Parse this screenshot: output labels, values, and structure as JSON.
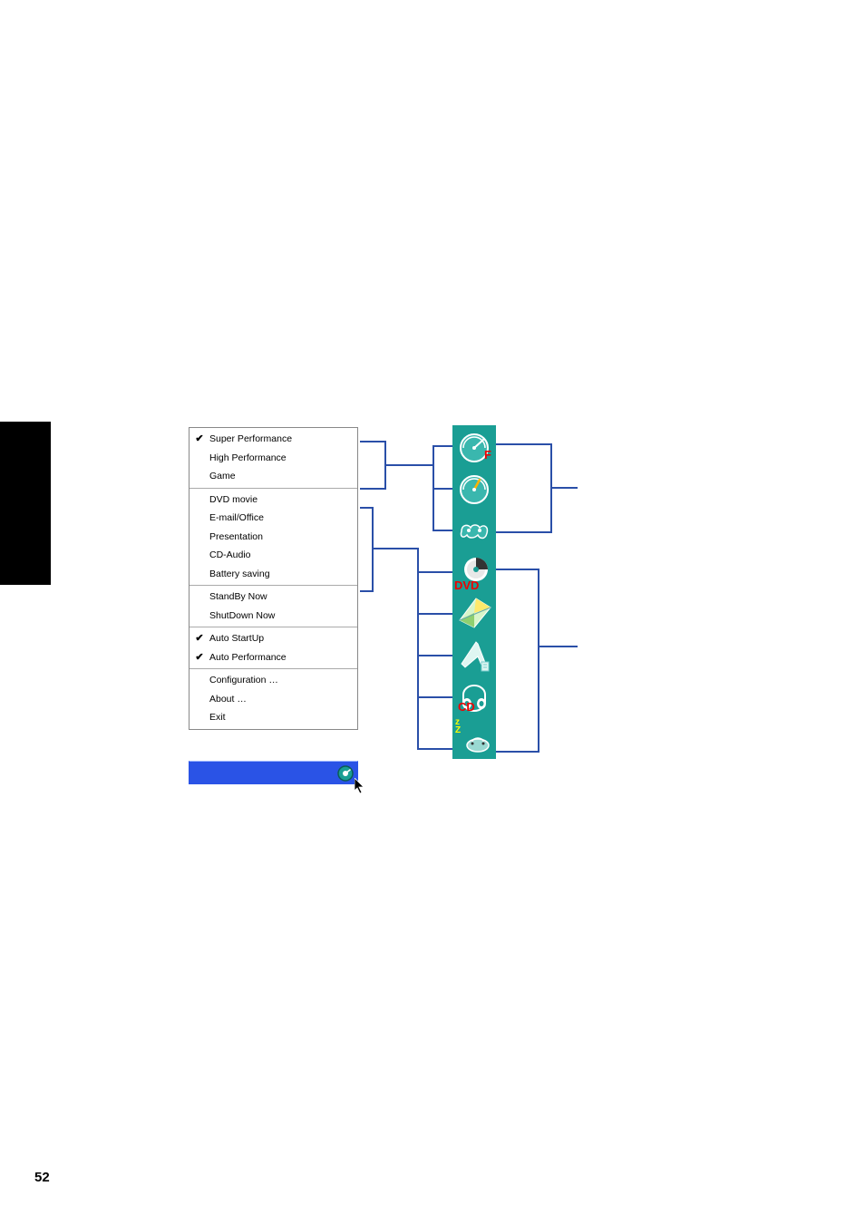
{
  "page_number": "52",
  "menu": {
    "groups": [
      {
        "items": [
          {
            "label": "Super Performance",
            "checked": true,
            "name": "menu-item-super-performance"
          },
          {
            "label": "High Performance",
            "checked": false,
            "name": "menu-item-high-performance"
          },
          {
            "label": "Game",
            "checked": false,
            "name": "menu-item-game"
          }
        ]
      },
      {
        "items": [
          {
            "label": "DVD movie",
            "checked": false,
            "name": "menu-item-dvd-movie"
          },
          {
            "label": "E-mail/Office",
            "checked": false,
            "name": "menu-item-email-office"
          },
          {
            "label": "Presentation",
            "checked": false,
            "name": "menu-item-presentation"
          },
          {
            "label": "CD-Audio",
            "checked": false,
            "name": "menu-item-cd-audio"
          },
          {
            "label": "Battery saving",
            "checked": false,
            "name": "menu-item-battery-saving"
          }
        ]
      },
      {
        "items": [
          {
            "label": "StandBy Now",
            "checked": false,
            "name": "menu-item-standby-now"
          },
          {
            "label": "ShutDown Now",
            "checked": false,
            "name": "menu-item-shutdown-now"
          }
        ]
      },
      {
        "items": [
          {
            "label": "Auto StartUp",
            "checked": true,
            "name": "menu-item-auto-startup"
          },
          {
            "label": "Auto Performance",
            "checked": true,
            "name": "menu-item-auto-performance"
          }
        ]
      },
      {
        "items": [
          {
            "label": "Configuration …",
            "checked": false,
            "name": "menu-item-configuration"
          },
          {
            "label": "About …",
            "checked": false,
            "name": "menu-item-about"
          },
          {
            "label": "Exit",
            "checked": false,
            "name": "menu-item-exit"
          }
        ]
      }
    ]
  },
  "icons": [
    {
      "name": "super-performance-icon"
    },
    {
      "name": "high-performance-icon"
    },
    {
      "name": "game-icon"
    },
    {
      "name": "dvd-movie-icon",
      "badge": "DVD"
    },
    {
      "name": "email-office-icon"
    },
    {
      "name": "presentation-icon"
    },
    {
      "name": "cd-audio-icon",
      "badge": "CD"
    },
    {
      "name": "battery-saving-icon",
      "badge_z": "z\nZ"
    }
  ],
  "colors": {
    "icon_bg": "#1a9e94",
    "connector": "#2a4fa8",
    "taskbar": "#2a53e6",
    "badge_red": "#e00"
  }
}
